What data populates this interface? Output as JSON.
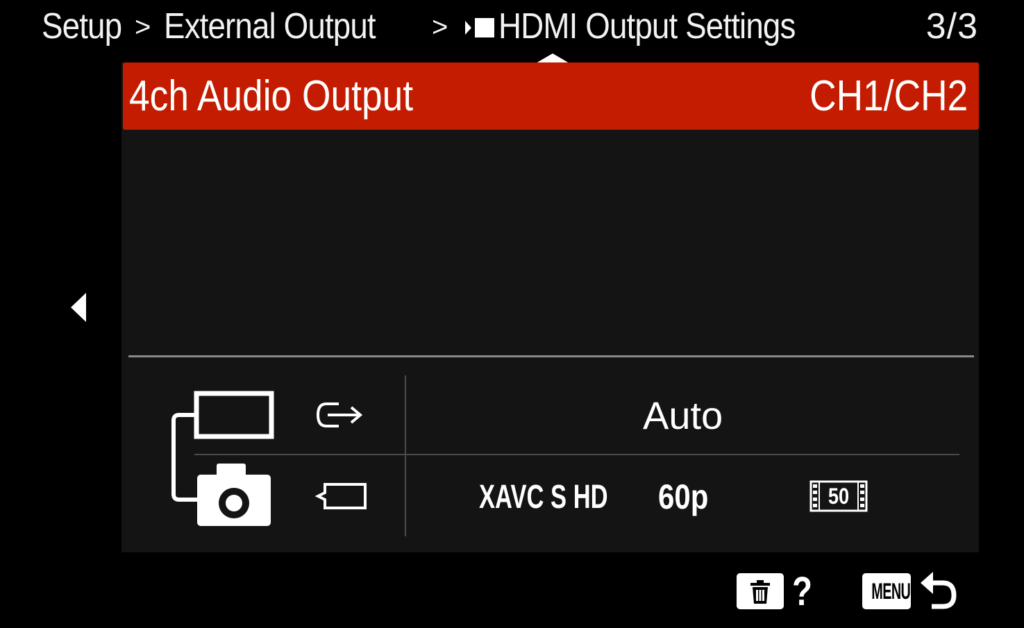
{
  "breadcrumb": {
    "root": "Setup",
    "separator_1": ">",
    "section": "External Output",
    "separator_2": ">",
    "page": "HDMI Output Settings",
    "page_icon": "movie-mode-icon"
  },
  "pager": {
    "label": "3/3"
  },
  "menu": {
    "item_label": "4ch Audio Output",
    "item_value": "CH1/CH2"
  },
  "status": {
    "output_resolution": "Auto",
    "codec": "XAVC S HD",
    "frame_rate": "60p",
    "bitrate": "50"
  },
  "footer": {
    "help_label": "?",
    "menu_label": "MENU"
  },
  "colors": {
    "highlight": "#c31c00",
    "panel": "#141414",
    "background": "#000000"
  }
}
